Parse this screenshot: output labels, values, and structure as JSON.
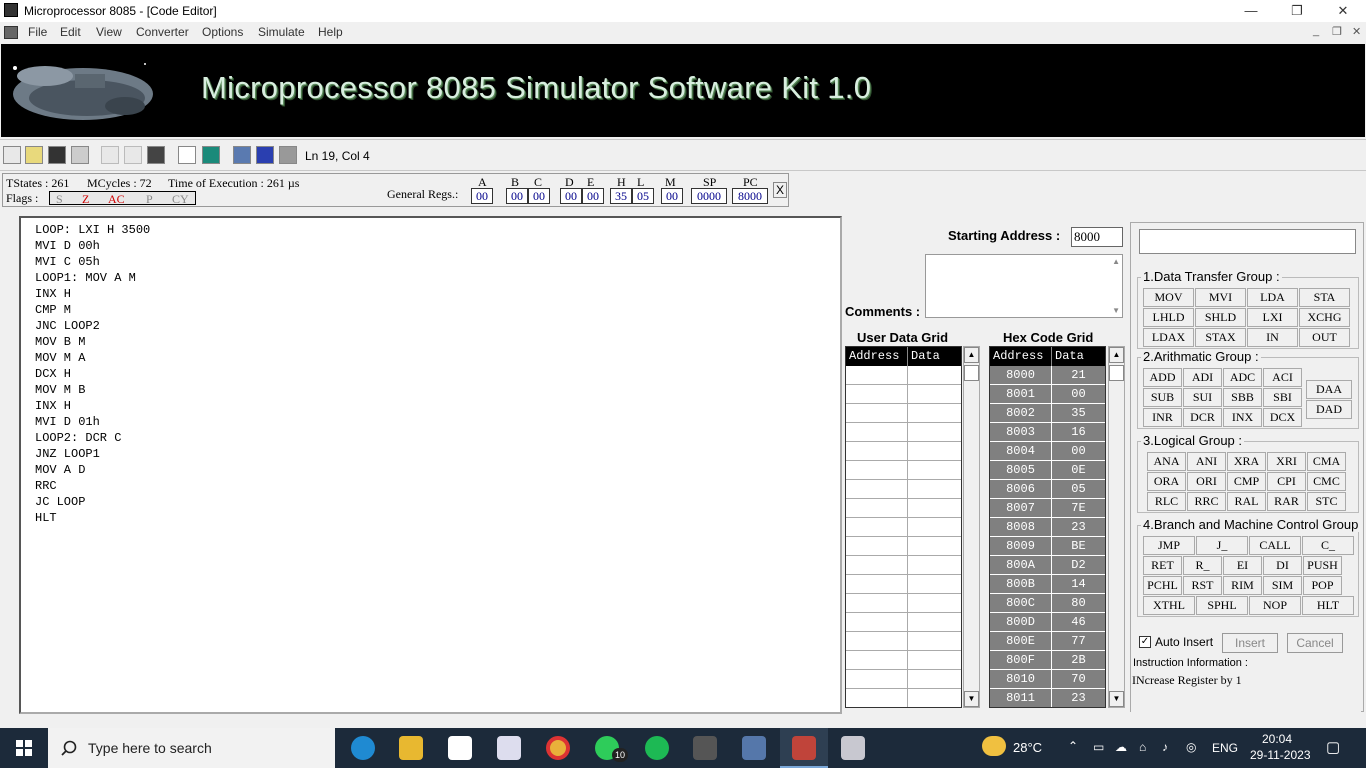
{
  "window": {
    "title": "Microprocessor 8085 - [Code Editor]",
    "controls": {
      "minimize": "—",
      "restore": "❐",
      "close": "✕"
    }
  },
  "menu": [
    "File",
    "Edit",
    "View",
    "Converter",
    "Options",
    "Simulate",
    "Help"
  ],
  "banner": {
    "title": "Microprocessor 8085 Simulator Software Kit 1.0"
  },
  "toolbar": {
    "icons": [
      "list-icon",
      "open-folder-icon",
      "save-icon",
      "print-icon",
      "cut-icon",
      "copy-icon",
      "paste-icon",
      "clock-icon",
      "monitor-icon",
      "convert-icon",
      "step-icon",
      "stop-icon"
    ],
    "cursor_position": "Ln 19, Col 4"
  },
  "status": {
    "tstates": "TStates : 261",
    "mcycles": "MCycles : 72",
    "time": "Time of Execution : 261 µs",
    "flags_label": "Flags :",
    "flags": [
      {
        "name": "S",
        "active": false
      },
      {
        "name": "Z",
        "active": true
      },
      {
        "name": "AC",
        "active": true
      },
      {
        "name": "P",
        "active": false
      },
      {
        "name": "CY",
        "active": false
      }
    ],
    "general_regs_label": "General Regs.:",
    "close_label": "X"
  },
  "registers": [
    {
      "name": "A",
      "value": "00"
    },
    {
      "name": "B",
      "value": "00"
    },
    {
      "name": "C",
      "value": "00"
    },
    {
      "name": "D",
      "value": "00"
    },
    {
      "name": "E",
      "value": "00"
    },
    {
      "name": "H",
      "value": "35"
    },
    {
      "name": "L",
      "value": "05"
    },
    {
      "name": "M",
      "value": "00"
    },
    {
      "name": "SP",
      "value": "0000"
    },
    {
      "name": "PC",
      "value": "8000"
    }
  ],
  "code": [
    "LOOP: LXI H 3500",
    "MVI D 00h",
    "MVI C 05h",
    "LOOP1: MOV A M",
    "INX H",
    "CMP M",
    "JNC LOOP2",
    "MOV B M",
    "MOV M A",
    "DCX H",
    "MOV M B",
    "INX H",
    "MVI D 01h",
    "LOOP2: DCR C",
    "JNZ LOOP1",
    "MOV A D",
    "RRC",
    "JC LOOP",
    "HLT"
  ],
  "start": {
    "label": "Starting Address :",
    "value": "8000"
  },
  "comments_label": "Comments :",
  "user_grid": {
    "title": "User Data Grid",
    "headers": [
      "Address",
      "Data"
    ]
  },
  "hex_grid": {
    "title": "Hex Code Grid",
    "headers": [
      "Address",
      "Data"
    ],
    "rows": [
      [
        "8000",
        "21"
      ],
      [
        "8001",
        "00"
      ],
      [
        "8002",
        "35"
      ],
      [
        "8003",
        "16"
      ],
      [
        "8004",
        "00"
      ],
      [
        "8005",
        "0E"
      ],
      [
        "8006",
        "05"
      ],
      [
        "8007",
        "7E"
      ],
      [
        "8008",
        "23"
      ],
      [
        "8009",
        "BE"
      ],
      [
        "800A",
        "D2"
      ],
      [
        "800B",
        "14"
      ],
      [
        "800C",
        "80"
      ],
      [
        "800D",
        "46"
      ],
      [
        "800E",
        "77"
      ],
      [
        "800F",
        "2B"
      ],
      [
        "8010",
        "70"
      ],
      [
        "8011",
        "23"
      ]
    ]
  },
  "groups": {
    "data_transfer": {
      "title": "1.Data Transfer Group :",
      "buttons": [
        "MOV",
        "MVI",
        "LDA",
        "STA",
        "LHLD",
        "SHLD",
        "LXI",
        "XCHG",
        "LDAX",
        "STAX",
        "IN",
        "OUT"
      ]
    },
    "arithmetic": {
      "title": "2.Arithmatic  Group :",
      "buttons": [
        "ADD",
        "ADI",
        "ADC",
        "ACI",
        "SUB",
        "SUI",
        "SBB",
        "SBI",
        "INR",
        "DCR",
        "INX",
        "DCX"
      ],
      "side": [
        "DAA",
        "DAD"
      ]
    },
    "logical": {
      "title": "3.Logical  Group :",
      "buttons": [
        "ANA",
        "ANI",
        "XRA",
        "XRI",
        "CMA",
        "ORA",
        "ORI",
        "CMP",
        "CPI",
        "CMC",
        "RLC",
        "RRC",
        "RAL",
        "RAR",
        "STC"
      ]
    },
    "branch": {
      "title": "4.Branch and Machine Control Group",
      "buttons": [
        "JMP",
        "J_",
        "CALL",
        "C_",
        "RET",
        "R_",
        "EI",
        "DI",
        "PUSH",
        "PCHL",
        "RST",
        "RIM",
        "SIM",
        "POP",
        "XTHL",
        "SPHL",
        "NOP",
        "HLT"
      ]
    }
  },
  "auto_insert": {
    "label": "Auto Insert",
    "checked": true
  },
  "insert_label": "Insert",
  "cancel_label": "Cancel",
  "instruction_info": {
    "label": "Instruction Information :",
    "text": "INcrease Register by 1"
  },
  "taskbar": {
    "search_placeholder": "Type here to search",
    "whatsapp_badge": "10",
    "weather": "28°C",
    "lang": "ENG",
    "time": "20:04",
    "date": "29-11-2023"
  }
}
